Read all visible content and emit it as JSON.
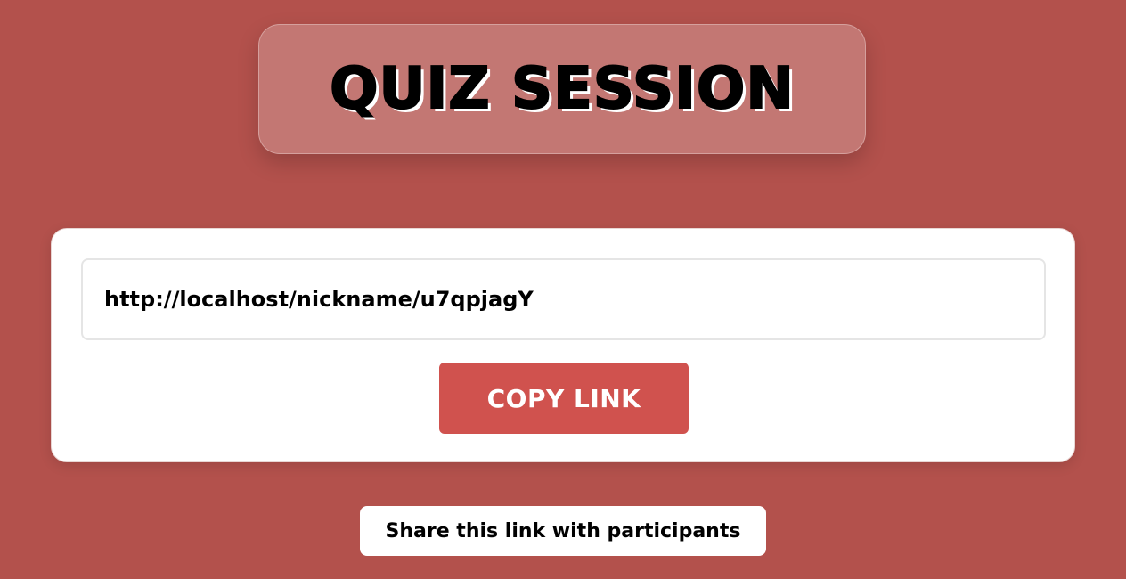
{
  "header": {
    "title": "QUIZ SESSION"
  },
  "share_card": {
    "link_value": "http://localhost/nickname/u7qpjagY",
    "copy_label": "COPY LINK"
  },
  "footer": {
    "note": "Share this link with participants"
  },
  "colors": {
    "background": "#b3514c",
    "button": "#d0524e",
    "card": "#ffffff"
  }
}
